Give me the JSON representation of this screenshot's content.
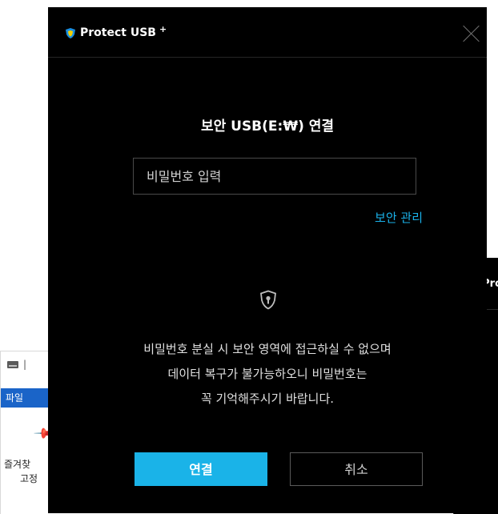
{
  "app": {
    "name": "Protect USB",
    "superscript": "+"
  },
  "dialog": {
    "title": "보안 USB(E:₩) 연결",
    "password_placeholder": "비밀번호 입력",
    "password_value": "",
    "manage_link": "보안 관리",
    "notice_lines": [
      "비밀번호 분실 시 보안 영역에 접근하실 수 없으며",
      "데이터 복구가 불가능하오니 비밀번호는",
      "꼭 기억해주시기 바랍니다."
    ],
    "connect_label": "연결",
    "cancel_label": "취소"
  },
  "background_explorer": {
    "separator": "|",
    "ribbon_tab": "파일",
    "quick_access_line1": "즐겨찾",
    "quick_access_line2": "고정"
  },
  "background_window": {
    "brand_partial": "Pro"
  },
  "colors": {
    "accent": "#1ab3e8",
    "background": "#000000",
    "shield_blue": "#1a8fe0",
    "shield_yellow": "#f5d000"
  }
}
